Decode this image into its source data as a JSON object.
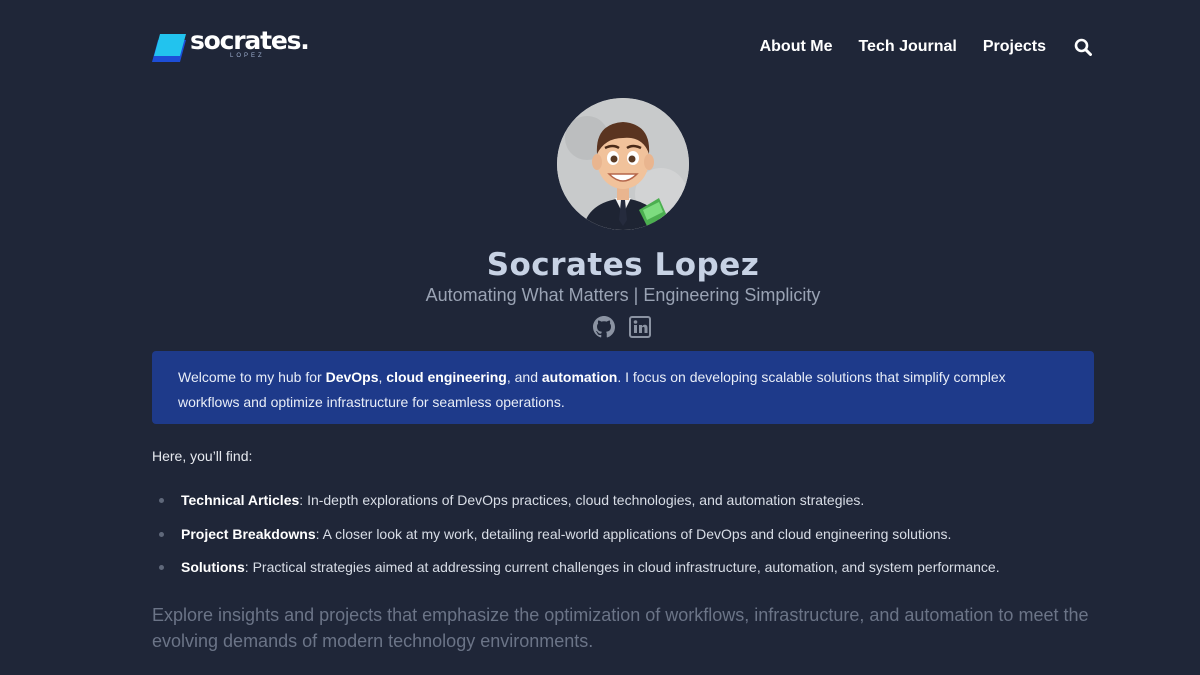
{
  "header": {
    "logo": {
      "wordmark": "socrates.",
      "subtext": "LOPEZ"
    },
    "nav": [
      {
        "label": "About Me"
      },
      {
        "label": "Tech Journal"
      },
      {
        "label": "Projects"
      }
    ],
    "search_icon": "search-icon"
  },
  "profile": {
    "name": "Socrates Lopez",
    "tagline": "Automating What Matters | Engineering Simplicity",
    "socials": [
      {
        "icon": "github-icon"
      },
      {
        "icon": "linkedin-icon"
      }
    ]
  },
  "callout": {
    "text_1": "Welcome to my hub for ",
    "bold_1": "DevOps",
    "text_2": ", ",
    "bold_2": "cloud engineering",
    "text_3": ", and ",
    "bold_3": "automation",
    "text_4": ". I focus on developing scalable solutions that simplify complex workflows and optimize infrastructure for seamless operations."
  },
  "intro": "Here, you’ll find:",
  "features": [
    {
      "title": "Technical Articles",
      "sep": ": ",
      "text": "In-depth explorations of DevOps practices, cloud technologies, and automation strategies."
    },
    {
      "title": "Project Breakdowns",
      "sep": ": ",
      "text": "A closer look at my work, detailing real-world applications of DevOps and cloud engineering solutions."
    },
    {
      "title": "Solutions",
      "sep": ": ",
      "text": "Practical strategies aimed at addressing current challenges in cloud infrastructure, automation, and system performance."
    }
  ],
  "closing": "Explore insights and projects that emphasize the optimization of workflows, infrastructure, and automation to meet the evolving demands of modern technology environments.",
  "colors": {
    "background": "#1f2638",
    "callout": "#1e3a8a",
    "logo_accent": "#22c3ee"
  }
}
